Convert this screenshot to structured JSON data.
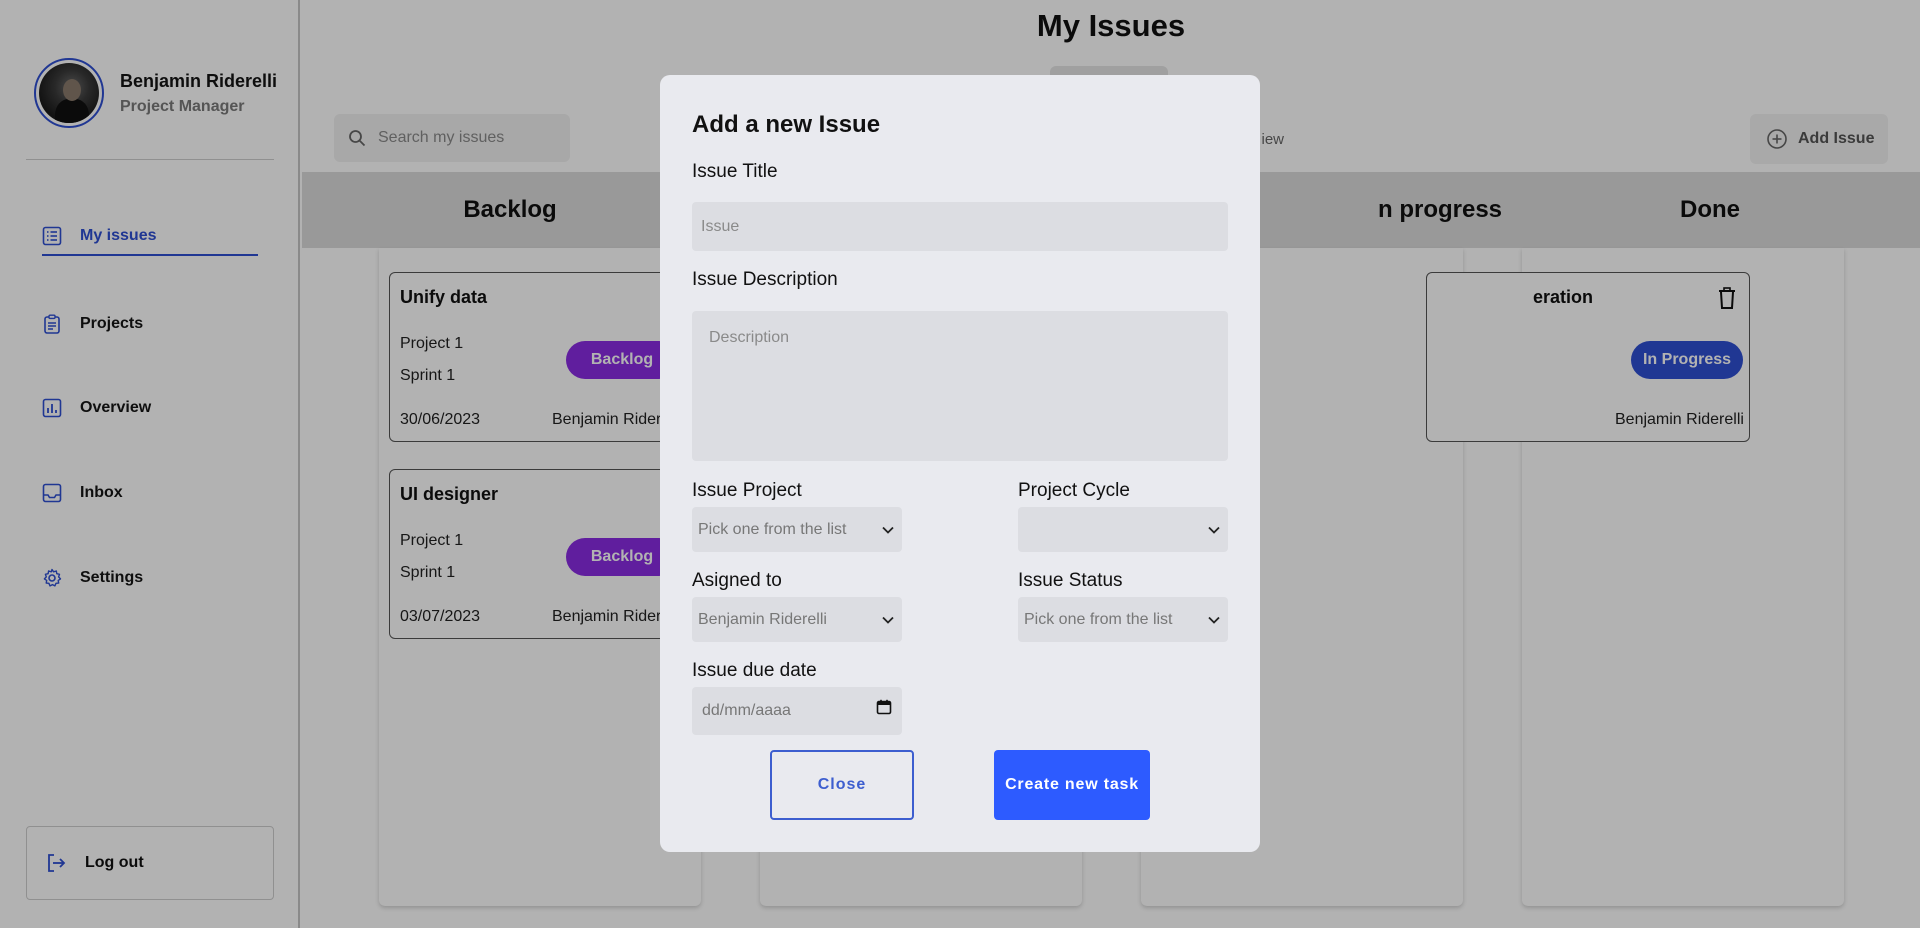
{
  "profile": {
    "name": "Benjamin Riderelli",
    "role": "Project Manager"
  },
  "sidebar": {
    "items": [
      {
        "label": "My issues",
        "icon": "list-icon",
        "active": true
      },
      {
        "label": "Projects",
        "icon": "clipboard-icon"
      },
      {
        "label": "Overview",
        "icon": "chart-icon"
      },
      {
        "label": "Inbox",
        "icon": "inbox-icon"
      },
      {
        "label": "Settings",
        "icon": "gear-icon"
      }
    ],
    "logout_label": "Log out"
  },
  "main": {
    "title": "My Issues",
    "search_placeholder": "Search my issues",
    "view_label": "iew",
    "add_issue_label": "Add Issue",
    "columns": [
      "Backlog",
      "n progress",
      "Done"
    ]
  },
  "cards": [
    {
      "title": "Unify data",
      "project": "Project 1",
      "sprint": "Sprint 1",
      "date": "30/06/2023",
      "assignee": "Benjamin Riderelli",
      "status": "Backlog",
      "status_color": "#8a2be2"
    },
    {
      "title": "UI designer",
      "project": "Project 1",
      "sprint": "Sprint 1",
      "date": "03/07/2023",
      "assignee": "Benjamin Riderelli",
      "status": "Backlog",
      "status_color": "#8a2be2"
    },
    {
      "title": "eration",
      "assignee": "Benjamin Riderelli",
      "status": "In Progress",
      "status_color": "#2f4fd3"
    }
  ],
  "modal": {
    "title": "Add a new Issue",
    "issue_title_label": "Issue Title",
    "issue_title_placeholder": "Issue",
    "description_label": "Issue Description",
    "description_placeholder": "Description",
    "project_label": "Issue Project",
    "project_value": "Pick one from the list",
    "cycle_label": "Project Cycle",
    "cycle_value": "",
    "assigned_label": "Asigned to",
    "assigned_value": "Benjamin Riderelli",
    "status_label": "Issue Status",
    "status_value": "Pick one from the list",
    "due_label": "Issue due date",
    "due_placeholder": "dd/mm/aaaa",
    "close_label": "Close",
    "create_label": "Create new task"
  },
  "colors": {
    "accent": "#2f4fd3",
    "primary_button": "#2d5bff",
    "backlog_badge": "#8a2be2"
  }
}
